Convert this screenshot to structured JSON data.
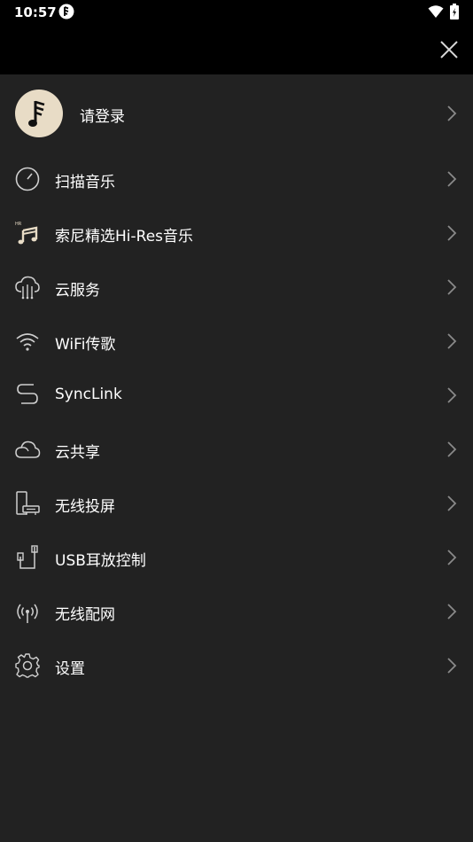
{
  "status_bar": {
    "time": "10:57"
  },
  "menu": {
    "login_label": "请登录",
    "items": [
      {
        "label": "扫描音乐",
        "icon": "scan-music-icon"
      },
      {
        "label": "索尼精选Hi-Res音乐",
        "icon": "hi-res-music-icon",
        "badge": "HR"
      },
      {
        "label": "云服务",
        "icon": "cloud-service-icon"
      },
      {
        "label": "WiFi传歌",
        "icon": "wifi-transfer-icon"
      },
      {
        "label": "SyncLink",
        "icon": "synclink-icon"
      },
      {
        "label": "云共享",
        "icon": "cloud-share-icon"
      },
      {
        "label": "无线投屏",
        "icon": "wireless-cast-icon"
      },
      {
        "label": "USB耳放控制",
        "icon": "usb-amp-icon"
      },
      {
        "label": "无线配网",
        "icon": "wireless-network-icon"
      },
      {
        "label": "设置",
        "icon": "gear-icon"
      }
    ]
  },
  "colors": {
    "background": "#222222",
    "bar": "#000000",
    "accent": "#e8dcc6",
    "icon": "#cfcfcf",
    "chevron": "#8a8a8a"
  }
}
